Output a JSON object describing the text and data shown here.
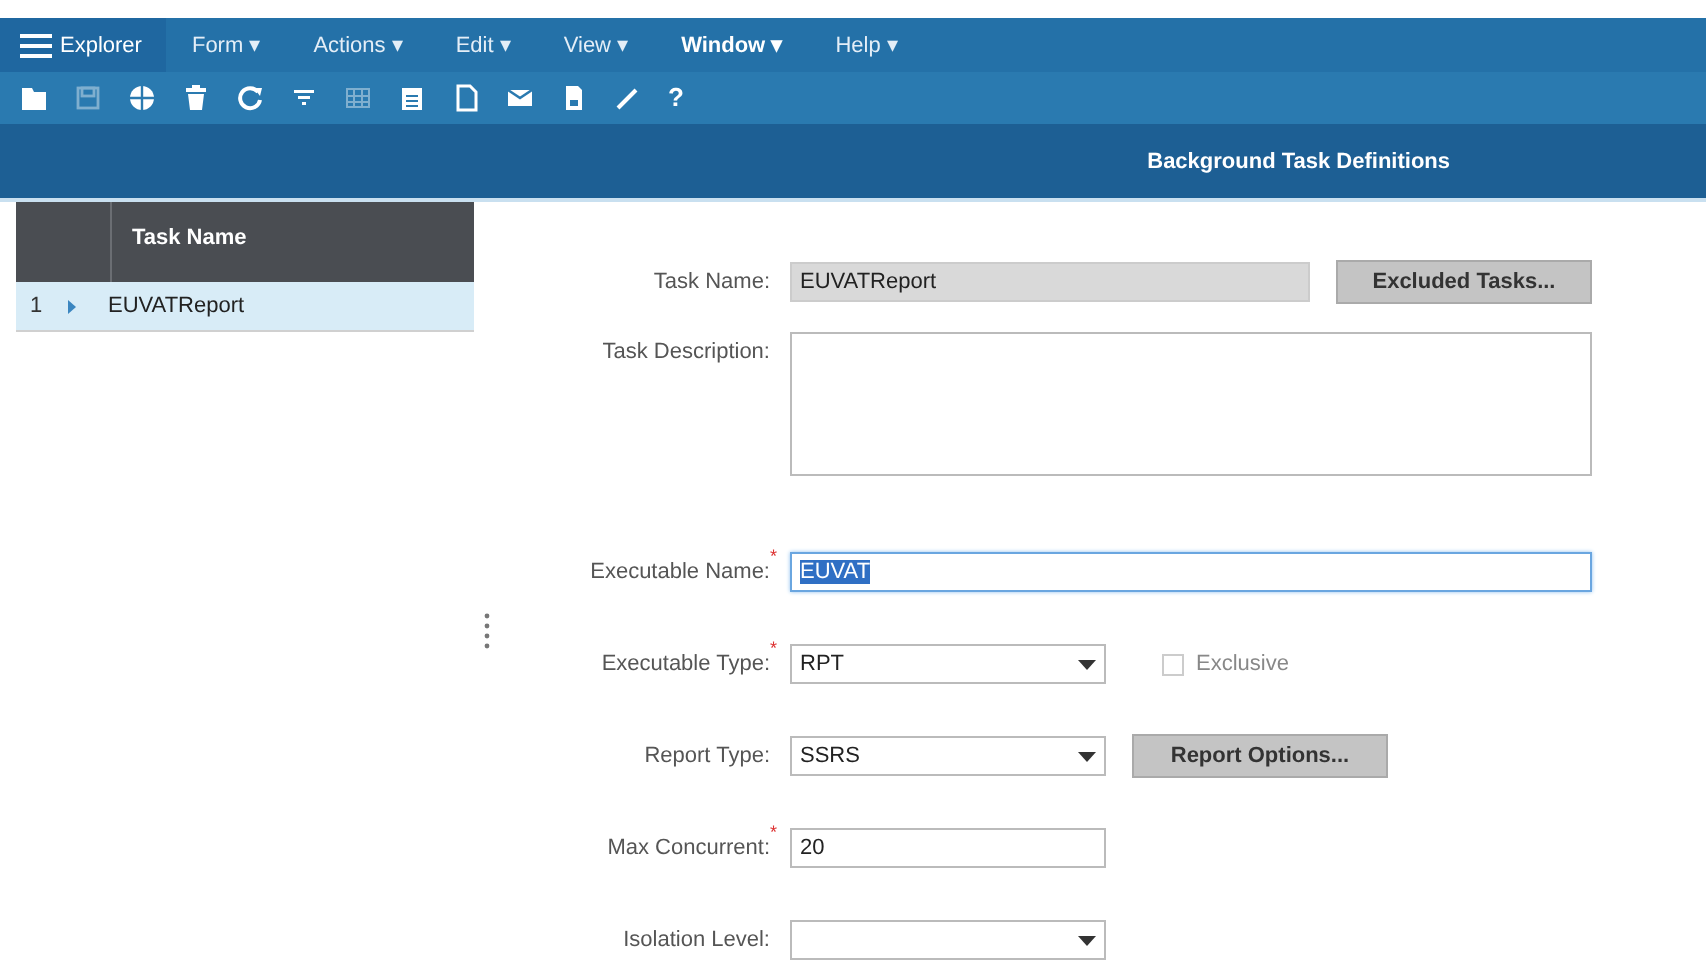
{
  "menu_bar": {
    "explorer": "Explorer",
    "menus": [
      {
        "label": "Form ▾",
        "selected": false
      },
      {
        "label": "Actions ▾",
        "selected": false
      },
      {
        "label": "Edit ▾",
        "selected": false
      },
      {
        "label": "View ▾",
        "selected": false
      },
      {
        "label": "Window ▾",
        "selected": true
      },
      {
        "label": "Help ▾",
        "selected": false
      }
    ]
  },
  "toolbar": [
    {
      "kind": "folder",
      "disabled": false
    },
    {
      "kind": "save",
      "disabled": true
    },
    {
      "kind": "globe",
      "disabled": false
    },
    {
      "kind": "trash",
      "disabled": false
    },
    {
      "kind": "refresh",
      "disabled": false
    },
    {
      "kind": "filter",
      "disabled": false
    },
    {
      "kind": "grid",
      "disabled": true
    },
    {
      "kind": "calendar",
      "disabled": false
    },
    {
      "kind": "document",
      "disabled": false
    },
    {
      "kind": "mail",
      "disabled": false
    },
    {
      "kind": "page",
      "disabled": false
    },
    {
      "kind": "pencil",
      "disabled": false
    },
    {
      "kind": "help",
      "label": "?",
      "disabled": false
    }
  ],
  "title": "Background Task Definitions",
  "grid": {
    "column": "Task Name",
    "rows": [
      {
        "number": "1",
        "name": "EUVATReport",
        "selected": true
      }
    ]
  },
  "form": [
    {
      "kind": "text",
      "label": "Task Name:",
      "value": "EUVATReport",
      "disabled": true,
      "button": "Excluded Tasks..."
    },
    {
      "kind": "textarea",
      "label": "Task Description:"
    },
    {
      "kind": "text",
      "label": "Executable Name:",
      "required_mark": "*",
      "value": "EUVAT",
      "disabled": false,
      "wide": true,
      "focused": true
    },
    {
      "kind": "select",
      "label": "Executable Type:",
      "required_mark": "*",
      "value": "RPT",
      "checkbox": {
        "label": "Exclusive",
        "checked": false
      }
    },
    {
      "kind": "select",
      "label": "Report Type:",
      "value": "SSRS",
      "button": "Report Options..."
    },
    {
      "kind": "text",
      "label": "Max Concurrent:",
      "required_mark": "*",
      "value": "20",
      "disabled": false
    },
    {
      "kind": "select",
      "label": "Isolation Level:"
    }
  ]
}
